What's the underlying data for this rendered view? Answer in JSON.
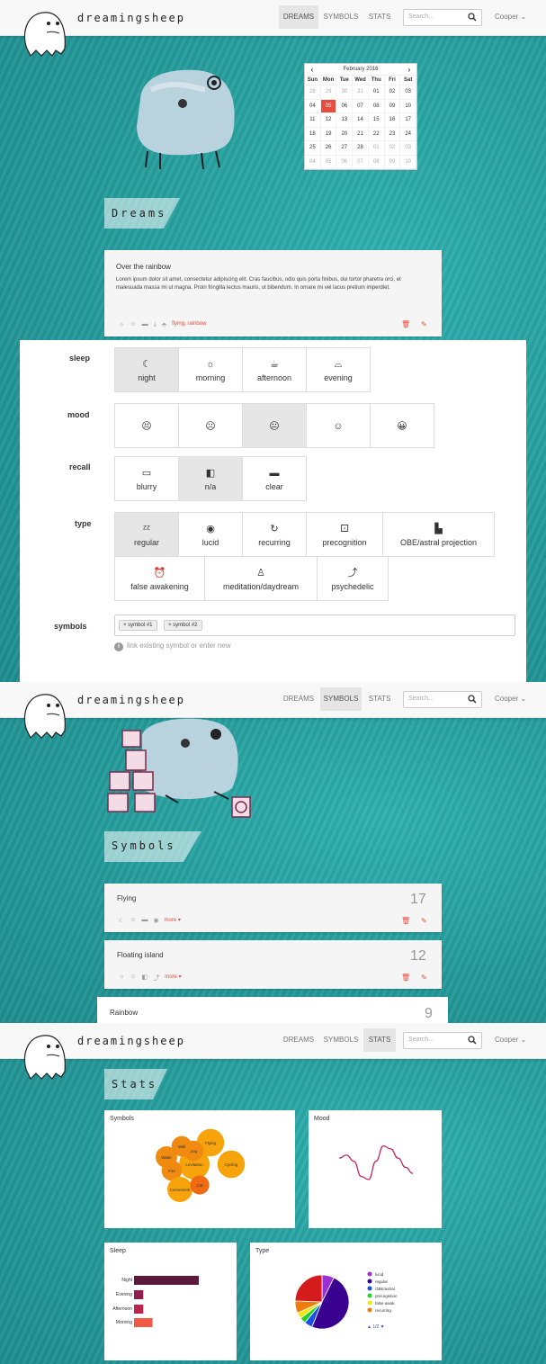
{
  "brand": "dreamingsheep",
  "nav": {
    "items": [
      "DREAMS",
      "SYMBOLS",
      "STATS"
    ],
    "search_placeholder": "Search...",
    "user": "Cooper"
  },
  "calendar": {
    "month_label": "February 2016",
    "prev": "‹",
    "next": "›",
    "dow": [
      "Sun",
      "Mon",
      "Tue",
      "Wed",
      "Thu",
      "Fri",
      "Sat"
    ],
    "weeks": [
      [
        "28",
        "29",
        "30",
        "31",
        "01",
        "02",
        "03"
      ],
      [
        "04",
        "05",
        "06",
        "07",
        "08",
        "09",
        "10"
      ],
      [
        "11",
        "12",
        "13",
        "14",
        "15",
        "16",
        "17"
      ],
      [
        "18",
        "19",
        "20",
        "21",
        "22",
        "23",
        "24"
      ],
      [
        "25",
        "26",
        "27",
        "28",
        "01",
        "02",
        "03"
      ],
      [
        "04",
        "05",
        "06",
        "07",
        "08",
        "09",
        "10"
      ]
    ],
    "selected": "05"
  },
  "dreams": {
    "heading": "Dreams",
    "card": {
      "title": "Over the rainbow",
      "body": "Lorem ipsum dolor sit amet, consectetur adipiscing elit. Cras faucibus, odio quis porta finibus, dui tortor pharetra orci, et malesuada massa mi ut magna. Proin fringilla lectus mauris, ut bibendum. In ornare mi vel lacus pretium imperdiet.",
      "tags": "flying, rainbow"
    }
  },
  "form": {
    "sleep": {
      "label": "sleep",
      "options": [
        {
          "label": "night",
          "icon": "☾"
        },
        {
          "label": "morning",
          "icon": "☼"
        },
        {
          "label": "afternoon",
          "icon": "☕"
        },
        {
          "label": "evening",
          "icon": "⌓"
        }
      ],
      "selected": "night"
    },
    "mood": {
      "label": "mood",
      "options": [
        {
          "label": "",
          "icon": "😣"
        },
        {
          "label": "",
          "icon": "☹"
        },
        {
          "label": "",
          "icon": "😐"
        },
        {
          "label": "",
          "icon": "☺"
        },
        {
          "label": "",
          "icon": "😀"
        }
      ],
      "selected_index": 2
    },
    "recall": {
      "label": "recall",
      "options": [
        {
          "label": "blurry",
          "icon": "▭"
        },
        {
          "label": "n/a",
          "icon": "◧"
        },
        {
          "label": "clear",
          "icon": "▬"
        }
      ],
      "selected": "n/a"
    },
    "type": {
      "label": "type",
      "options": [
        {
          "label": "regular",
          "icon": "ᶻᶻ"
        },
        {
          "label": "lucid",
          "icon": "◉"
        },
        {
          "label": "recurring",
          "icon": "↻"
        },
        {
          "label": "precognition",
          "icon": "⚀"
        },
        {
          "label": "OBE/astral projection",
          "icon": "▙"
        },
        {
          "label": "false awakening",
          "icon": "⏰"
        },
        {
          "label": "meditation/daydream",
          "icon": "♙"
        },
        {
          "label": "psychedelic",
          "icon": "⤴"
        }
      ],
      "selected": "regular"
    },
    "symbols": {
      "label": "symbols",
      "chips": [
        "× symbol #1",
        "× symbol #2"
      ],
      "hint": "link existing symbol or enter new"
    }
  },
  "symbols_page": {
    "heading": "Symbols",
    "items": [
      {
        "name": "Flying",
        "count": "17",
        "more": "more ▾"
      },
      {
        "name": "Floating island",
        "count": "12",
        "more": "more ▾"
      },
      {
        "name": "Rainbow",
        "count": "9"
      }
    ]
  },
  "stats_page": {
    "heading": "Stats",
    "panels": {
      "symbols": "Symbols",
      "mood": "Mood",
      "sleep": "Sleep",
      "type": "Type"
    }
  },
  "chart_data": [
    {
      "type": "scatter",
      "title": "Symbols",
      "bubbles": [
        {
          "label": "Flying",
          "value": 12
        },
        {
          "label": "Levitation",
          "value": 17
        },
        {
          "label": "Cycling",
          "value": 12
        },
        {
          "label": "Water",
          "value": 5
        },
        {
          "label": "Dog",
          "value": 4
        },
        {
          "label": "Mall",
          "value": 4
        },
        {
          "label": "Fire",
          "value": 4
        },
        {
          "label": "Convenient",
          "value": 9
        },
        {
          "label": "Cat",
          "value": 3
        }
      ]
    },
    {
      "type": "line",
      "title": "Mood",
      "x": [
        0,
        1,
        2,
        3,
        4,
        5,
        6,
        7,
        8,
        9,
        10
      ],
      "y": [
        0.2,
        0.3,
        0.1,
        -0.4,
        -0.5,
        0.1,
        0.6,
        0.5,
        0.2,
        -0.1,
        -0.3
      ]
    },
    {
      "type": "bar",
      "title": "Sleep",
      "orientation": "horizontal",
      "categories": [
        "Night",
        "Evening",
        "Afternoon",
        "Morning"
      ],
      "values": [
        14,
        2,
        2,
        4
      ],
      "colors": [
        "#5b1a3b",
        "#8e1f4f",
        "#b8254f",
        "#f05a45"
      ]
    },
    {
      "type": "pie",
      "title": "Type",
      "categories": [
        "lucid",
        "regular",
        "OBE/astral",
        "precognition",
        "false awak.",
        "recurring",
        ""
      ],
      "values": [
        6,
        40,
        4,
        3,
        3,
        6,
        20
      ],
      "colors": [
        "#9b30d8",
        "#3a0090",
        "#1a4ee8",
        "#28d028",
        "#f3e512",
        "#f07a0a",
        "#d41c1c"
      ],
      "legend_nav": "1/2"
    }
  ]
}
